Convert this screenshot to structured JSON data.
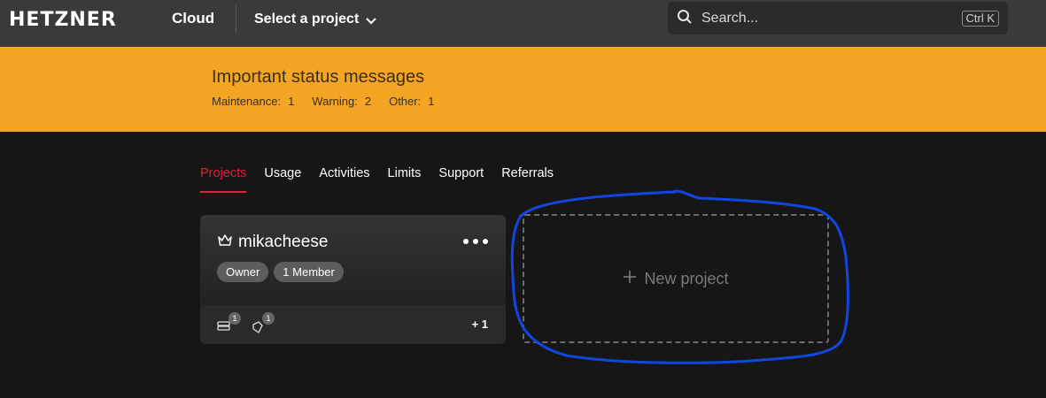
{
  "header": {
    "brand": "HETZNER",
    "product": "Cloud",
    "project_selector_label": "Select a project",
    "search_placeholder": "Search...",
    "search_shortcut": "Ctrl K"
  },
  "status_banner": {
    "title": "Important status messages",
    "items": [
      {
        "label": "Maintenance:",
        "count": "1"
      },
      {
        "label": "Warning:",
        "count": "2"
      },
      {
        "label": "Other:",
        "count": "1"
      }
    ]
  },
  "tabs": [
    {
      "label": "Projects",
      "active": true
    },
    {
      "label": "Usage",
      "active": false
    },
    {
      "label": "Activities",
      "active": false
    },
    {
      "label": "Limits",
      "active": false
    },
    {
      "label": "Support",
      "active": false
    },
    {
      "label": "Referrals",
      "active": false
    }
  ],
  "project_card": {
    "name": "mikacheese",
    "badges": [
      "Owner",
      "1 Member"
    ],
    "resources": [
      {
        "icon": "server-icon",
        "count": "1"
      },
      {
        "icon": "ip-tag-icon",
        "count": "1"
      }
    ],
    "more_label": "+ 1"
  },
  "new_project": {
    "label": "New project"
  },
  "colors": {
    "topbar": "#3a3a3a",
    "banner": "#f4a524",
    "active_tab": "#e31e3c",
    "background": "#161616",
    "annotation": "#1147e0"
  }
}
